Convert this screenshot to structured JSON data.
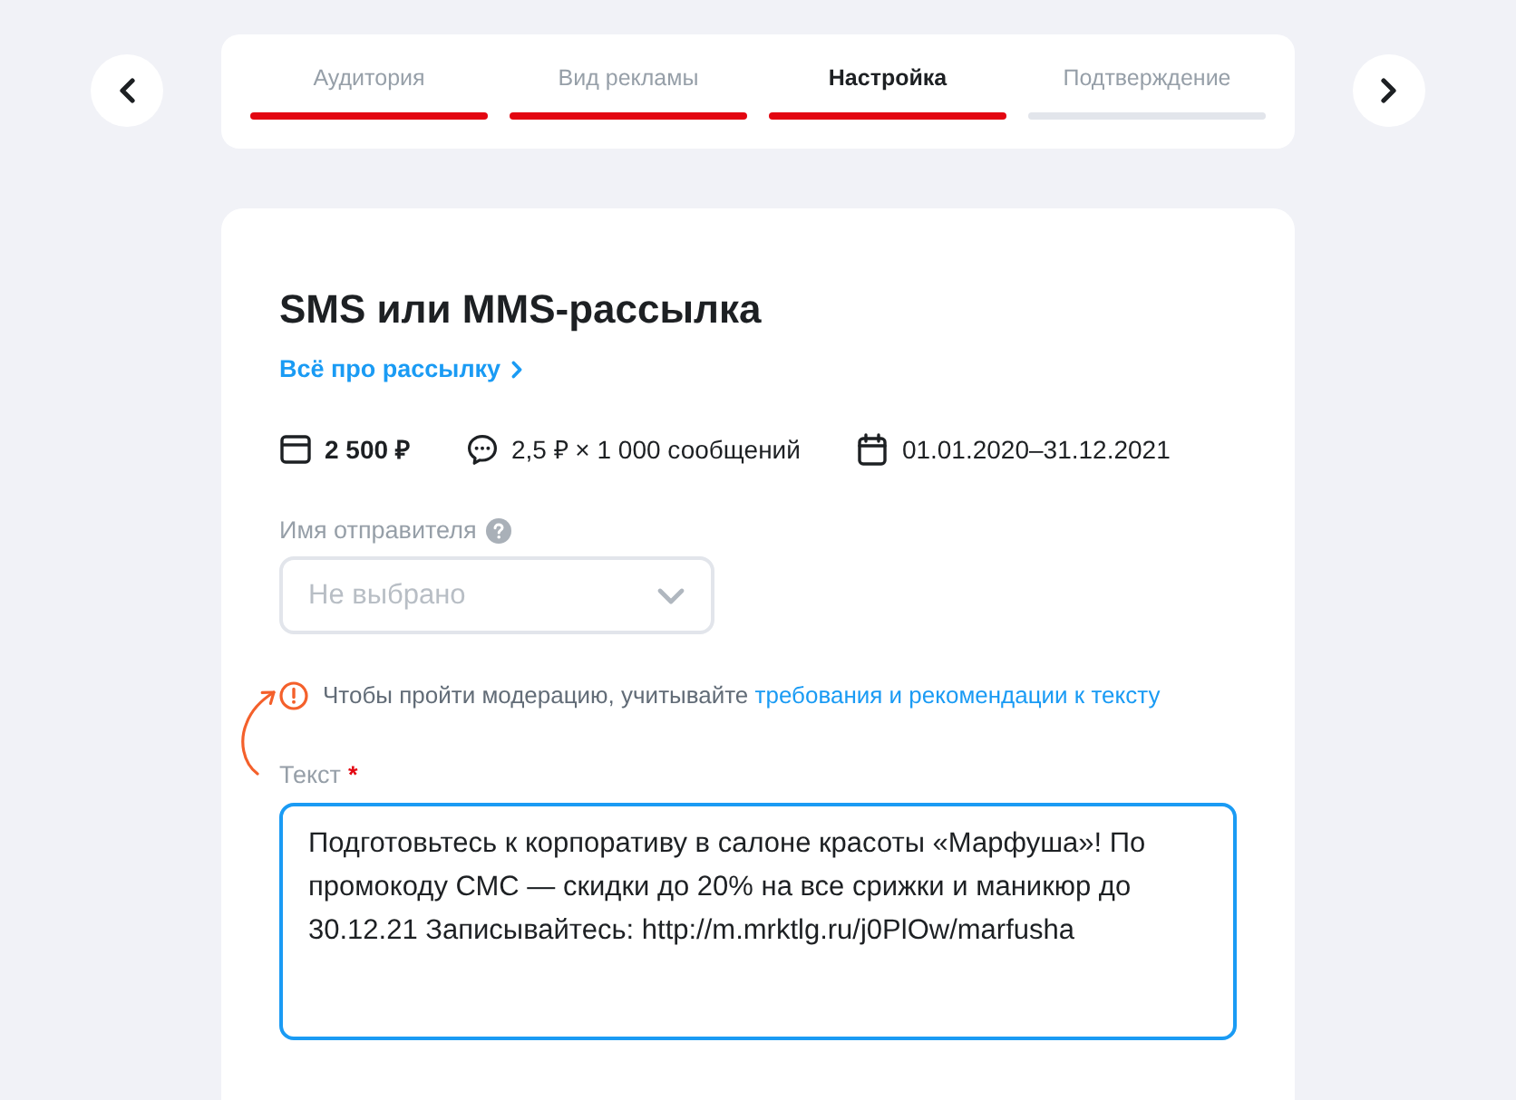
{
  "steps": [
    {
      "label": "Аудитория",
      "selected": false,
      "done": true
    },
    {
      "label": "Вид рекламы",
      "selected": false,
      "done": true
    },
    {
      "label": "Настройка",
      "selected": true,
      "done": true
    },
    {
      "label": "Подтверждение",
      "selected": false,
      "done": false
    }
  ],
  "campaign": {
    "title": "SMS или MMS-рассылка",
    "link": "Всё про рассылку",
    "stats": [
      {
        "kind": "budget",
        "text": "2 500 ₽",
        "bold": true
      },
      {
        "kind": "messages",
        "text": "2,5 ₽ × 1 000 сообщений",
        "bold": false
      },
      {
        "kind": "period",
        "text": "01.01.2020–31.12.2021",
        "bold": false
      }
    ],
    "sender": {
      "label": "Имя отправителя",
      "placeholder": "Не выбрано"
    },
    "hint": {
      "text": "Чтобы пройти модерацию, учитывайте",
      "link": "требования и рекомендации к тексту"
    },
    "message": {
      "label": "Текст",
      "required_mark": "*",
      "value": "Подготовьтесь к корпоративу в салоне красоты «Марфуша»! По промокоду СМС — скидки до 20% на все срижки и маникюр до 30.12.21 Записывайтесь: http://m.mrktlg.ru/j0PlOw/marfusha"
    }
  }
}
